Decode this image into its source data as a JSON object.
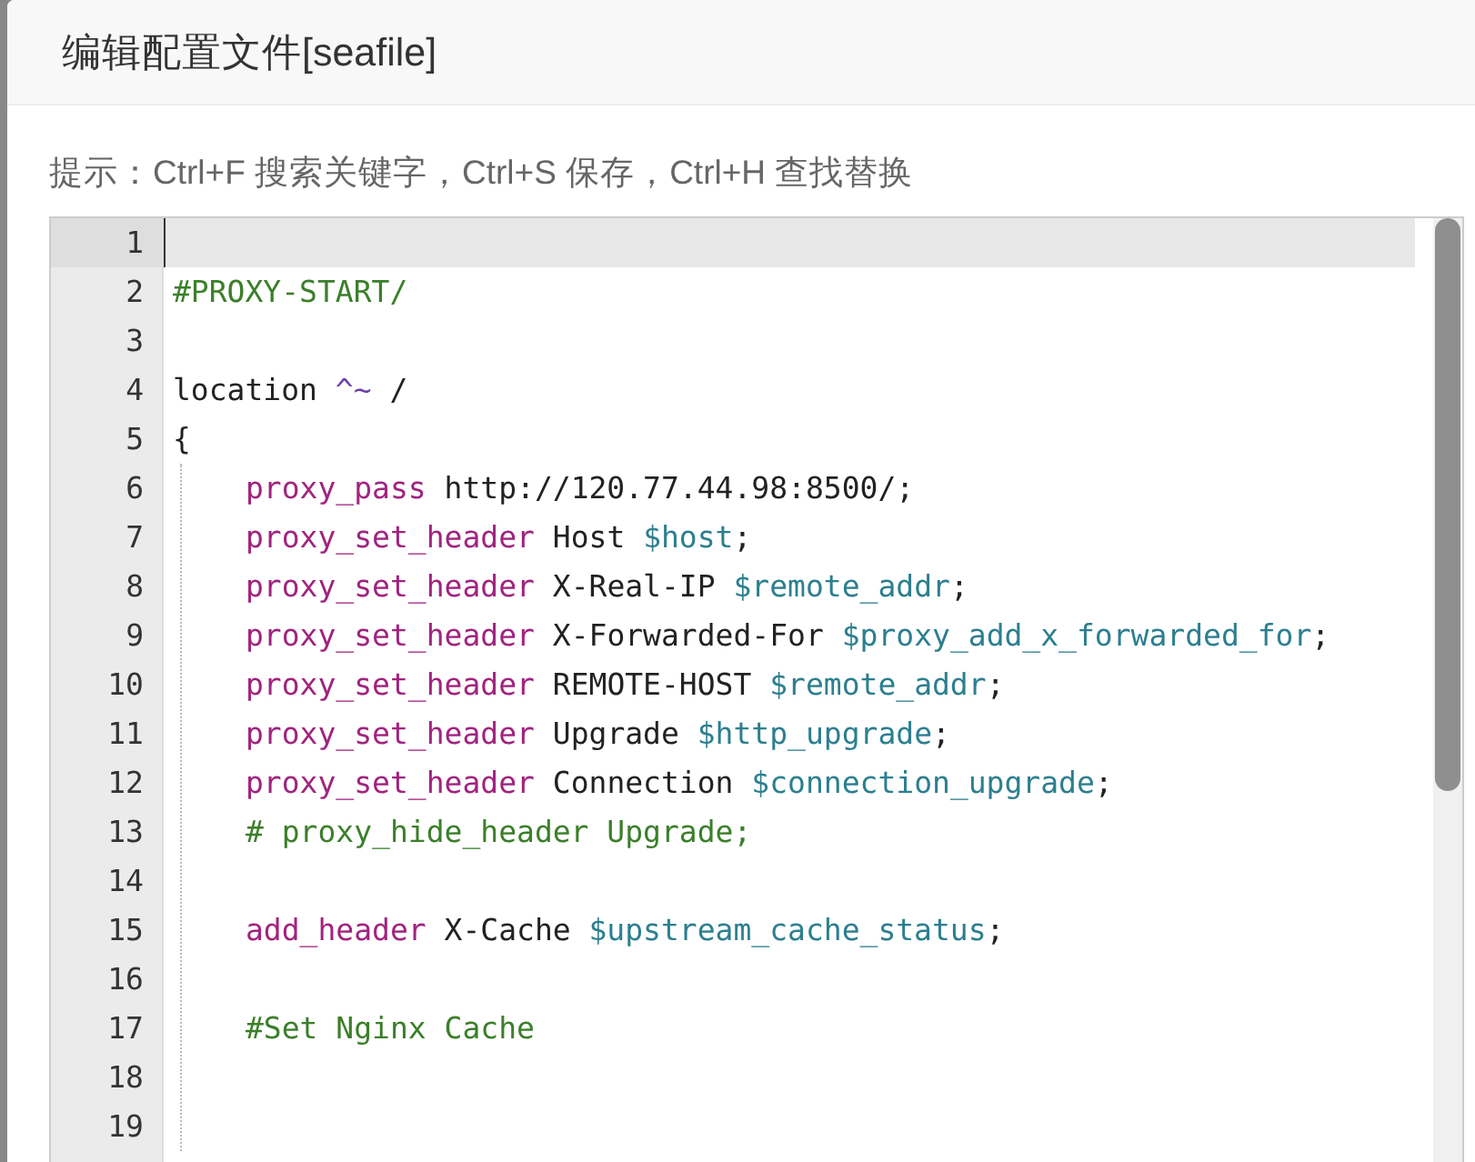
{
  "dialog": {
    "title": "编辑配置文件[seafile]"
  },
  "hint": "提示：Ctrl+F 搜索关键字，Ctrl+S 保存，Ctrl+H 查找替换",
  "editor": {
    "lines": [
      {
        "number": "1",
        "current": true
      },
      {
        "number": "2",
        "current": false,
        "tokens": [
          {
            "kind": "comment",
            "text": "#PROXY-START/"
          }
        ]
      },
      {
        "number": "3",
        "current": false
      },
      {
        "number": "4",
        "current": false,
        "tokens": [
          {
            "kind": "plain",
            "text": "location "
          },
          {
            "kind": "operator",
            "text": "^~"
          },
          {
            "kind": "plain",
            "text": " /"
          }
        ]
      },
      {
        "number": "5",
        "current": false,
        "tokens": [
          {
            "kind": "plain",
            "text": "{"
          }
        ],
        "children": [
          {
            "number": "6",
            "current": false,
            "tokens": [
              {
                "kind": "keyword",
                "text": "proxy_pass"
              },
              {
                "kind": "plain",
                "text": " http://120.77.44.98:8500/;"
              }
            ]
          },
          {
            "number": "7",
            "current": false,
            "tokens": [
              {
                "kind": "keyword",
                "text": "proxy_set_header"
              },
              {
                "kind": "plain",
                "text": " Host "
              },
              {
                "kind": "variable",
                "text": "$host"
              },
              {
                "kind": "plain",
                "text": ";"
              }
            ]
          },
          {
            "number": "8",
            "current": false,
            "tokens": [
              {
                "kind": "keyword",
                "text": "proxy_set_header"
              },
              {
                "kind": "plain",
                "text": " X-Real-IP "
              },
              {
                "kind": "variable",
                "text": "$remote_addr"
              },
              {
                "kind": "plain",
                "text": ";"
              }
            ]
          },
          {
            "number": "9",
            "current": false,
            "tokens": [
              {
                "kind": "keyword",
                "text": "proxy_set_header"
              },
              {
                "kind": "plain",
                "text": " X-Forwarded-For "
              },
              {
                "kind": "variable",
                "text": "$proxy_add_x_forwarded_for"
              },
              {
                "kind": "plain",
                "text": ";"
              }
            ]
          },
          {
            "number": "10",
            "current": false,
            "tokens": [
              {
                "kind": "keyword",
                "text": "proxy_set_header"
              },
              {
                "kind": "plain",
                "text": " REMOTE-HOST "
              },
              {
                "kind": "variable",
                "text": "$remote_addr"
              },
              {
                "kind": "plain",
                "text": ";"
              }
            ]
          },
          {
            "number": "11",
            "current": false,
            "tokens": [
              {
                "kind": "keyword",
                "text": "proxy_set_header"
              },
              {
                "kind": "plain",
                "text": " Upgrade "
              },
              {
                "kind": "variable",
                "text": "$http_upgrade"
              },
              {
                "kind": "plain",
                "text": ";"
              }
            ]
          },
          {
            "number": "12",
            "current": false,
            "tokens": [
              {
                "kind": "keyword",
                "text": "proxy_set_header"
              },
              {
                "kind": "plain",
                "text": " Connection "
              },
              {
                "kind": "variable",
                "text": "$connection_upgrade"
              },
              {
                "kind": "plain",
                "text": ";"
              }
            ]
          },
          {
            "number": "13",
            "current": false,
            "tokens": [
              {
                "kind": "comment",
                "text": "# proxy_hide_header Upgrade;"
              }
            ]
          },
          {
            "number": "14",
            "current": false
          },
          {
            "number": "15",
            "current": false,
            "tokens": [
              {
                "kind": "keyword",
                "text": "add_header"
              },
              {
                "kind": "plain",
                "text": " X-Cache "
              },
              {
                "kind": "variable",
                "text": "$upstream_cache_status"
              },
              {
                "kind": "plain",
                "text": ";"
              }
            ]
          },
          {
            "number": "16",
            "current": false
          },
          {
            "number": "17",
            "current": false,
            "tokens": [
              {
                "kind": "comment",
                "text": "#Set Nginx Cache"
              }
            ]
          },
          {
            "number": "18",
            "current": false
          },
          {
            "number": "19",
            "current": false
          }
        ]
      }
    ]
  }
}
